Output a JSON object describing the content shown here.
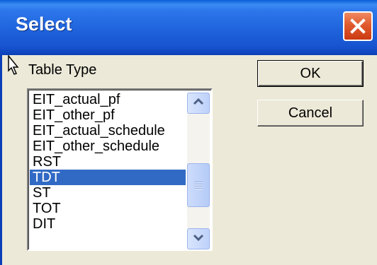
{
  "window": {
    "title": "Select",
    "close_icon": "close-icon"
  },
  "table_type": {
    "label": "Table Type",
    "items": [
      "EIT_actual_pf",
      "EIT_other_pf",
      "EIT_actual_schedule",
      "EIT_other_schedule",
      "RST",
      "TDT",
      "ST",
      "TOT",
      "DIT"
    ],
    "selected": "TDT"
  },
  "buttons": {
    "ok_label": "OK",
    "cancel_label": "Cancel"
  },
  "colors": {
    "titlebar": "#1f63dc",
    "selection": "#316ac5",
    "close_button": "#e05a2e"
  }
}
